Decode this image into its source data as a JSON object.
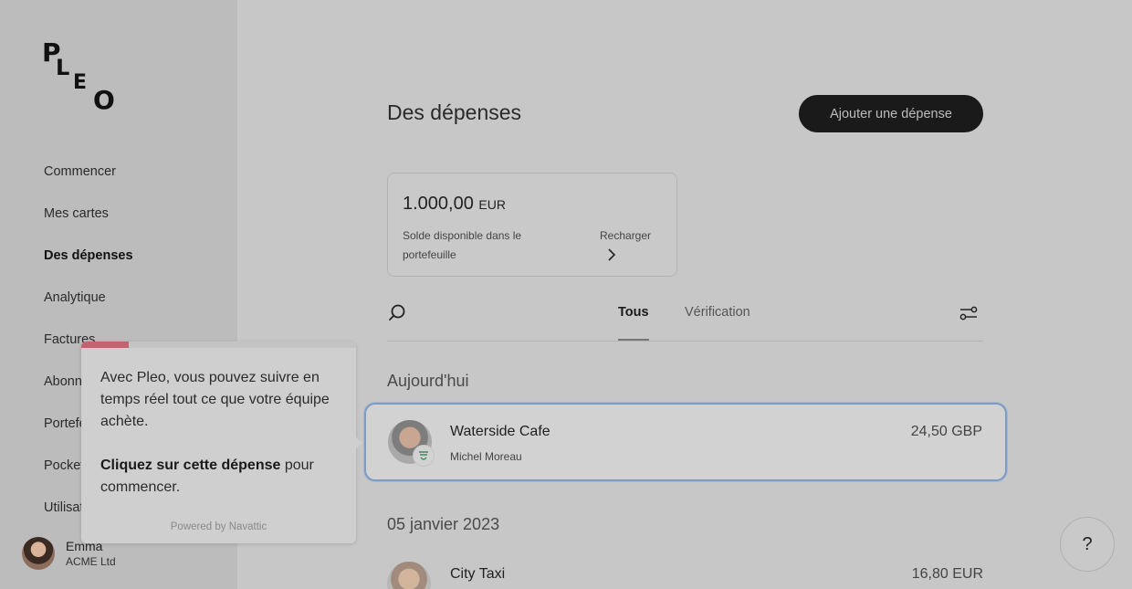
{
  "brand": {
    "logo_letters": [
      "P",
      "L",
      "E",
      "O"
    ]
  },
  "sidebar": {
    "items": [
      {
        "label": "Commencer",
        "active": false
      },
      {
        "label": "Mes cartes",
        "active": false
      },
      {
        "label": "Des dépenses",
        "active": true
      },
      {
        "label": "Analytique",
        "active": false
      },
      {
        "label": "Factures",
        "active": false
      },
      {
        "label": "Abonnements",
        "active": false
      },
      {
        "label": "Portefeuille",
        "active": false
      },
      {
        "label": "Pocket",
        "active": false
      },
      {
        "label": "Utilisateurs",
        "active": false
      }
    ],
    "user": {
      "name": "Emma",
      "org": "ACME Ltd"
    }
  },
  "header": {
    "title": "Des dépenses",
    "add_button": "Ajouter une dépense"
  },
  "wallet": {
    "amount": "1.000,00",
    "currency": "EUR",
    "label": "Solde disponible dans le portefeuille",
    "recharge": "Recharger"
  },
  "tabs": [
    {
      "label": "Tous",
      "active": true
    },
    {
      "label": "Vérification",
      "active": false
    }
  ],
  "sections": [
    {
      "title": "Aujourd'hui",
      "expenses": [
        {
          "merchant": "Waterside Cafe",
          "person": "Michel Moreau",
          "amount": "24,50 GBP",
          "category_icon": "food-icon"
        }
      ]
    },
    {
      "title": "05 janvier 2023",
      "expenses": [
        {
          "merchant": "City Taxi",
          "person": "",
          "amount": "16,80 EUR"
        }
      ]
    }
  ],
  "tooltip": {
    "text": "Avec Pleo, vous pouvez suivre en temps réel tout ce que votre équipe achète.",
    "cta_bold": "Cliquez sur cette dépense",
    "cta_rest": " pour commencer.",
    "powered": "Powered by Navattic",
    "accent_color": "#c0646f"
  },
  "help": {
    "label": "?"
  }
}
